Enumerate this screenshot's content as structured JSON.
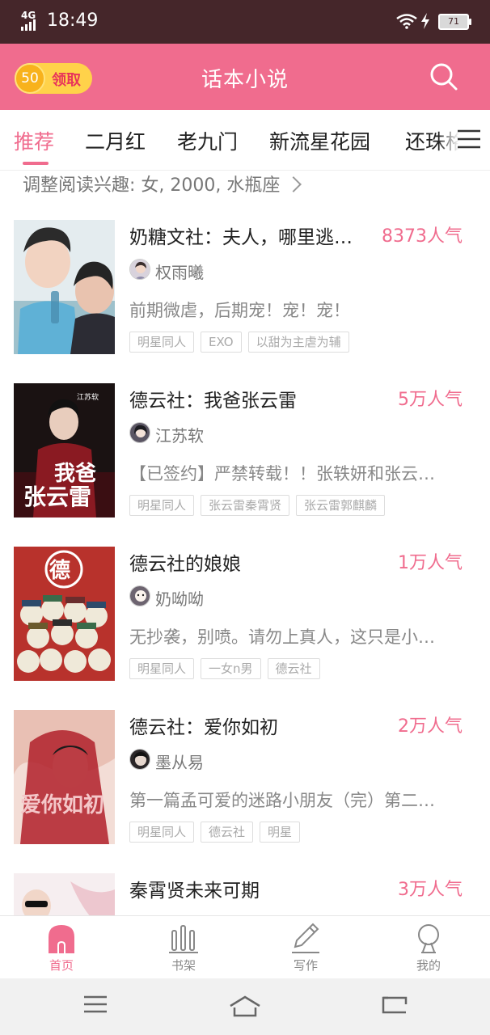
{
  "status_bar": {
    "network": "4G",
    "time": "18:49",
    "battery": "71"
  },
  "header": {
    "coin_amount": "50",
    "claim_label": "领取",
    "title": "话本小说"
  },
  "tabs": [
    {
      "label": "推荐",
      "active": true
    },
    {
      "label": "二月红",
      "active": false
    },
    {
      "label": "老九门",
      "active": false
    },
    {
      "label": "新流星花园",
      "active": false
    },
    {
      "label": "还珠格",
      "active": false
    }
  ],
  "interest": {
    "text": "调整阅读兴趣: 女, 2000, 水瓶座"
  },
  "books": [
    {
      "title": "奶糖文社：夫人，哪里逃…",
      "popularity": "8373人气",
      "author": "权雨曦",
      "description": "前期微虐，后期宠！宠！宠！",
      "tags": [
        "明星同人",
        "EXO",
        "以甜为主虐为辅"
      ]
    },
    {
      "title": "德云社：我爸张云雷",
      "popularity": "5万人气",
      "author": "江苏软",
      "description": "【已签约】严禁转载！！张轶妍和张云…",
      "tags": [
        "明星同人",
        "张云雷秦霄贤",
        "张云雷郭麒麟"
      ],
      "cover_text_top": "江苏软",
      "cover_text_main": "我爸张云雷"
    },
    {
      "title": "德云社的娘娘",
      "popularity": "1万人气",
      "author": "奶呦呦",
      "description": "无抄袭，别喷。请勿上真人，这只是小…",
      "tags": [
        "明星同人",
        "一女n男",
        "德云社"
      ],
      "cover_text_main": "德"
    },
    {
      "title": "德云社：爱你如初",
      "popularity": "2万人气",
      "author": "墨从易",
      "description": "第一篇孟可爱的迷路小朋友（完）第二…",
      "tags": [
        "明星同人",
        "德云社",
        "明星"
      ],
      "cover_text_main": "爱你如初"
    },
    {
      "title": "秦霄贤未来可期",
      "popularity": "3万人气",
      "author": "",
      "description": "",
      "tags": []
    }
  ],
  "bottom_nav": [
    {
      "label": "首页",
      "icon": "home-icon",
      "active": true
    },
    {
      "label": "书架",
      "icon": "bookshelf-icon",
      "active": false
    },
    {
      "label": "写作",
      "icon": "pencil-icon",
      "active": false
    },
    {
      "label": "我的",
      "icon": "profile-icon",
      "active": false
    }
  ],
  "colors": {
    "accent": "#f06c8e",
    "status_bar": "#45262a",
    "coin": "#ffd24a"
  }
}
